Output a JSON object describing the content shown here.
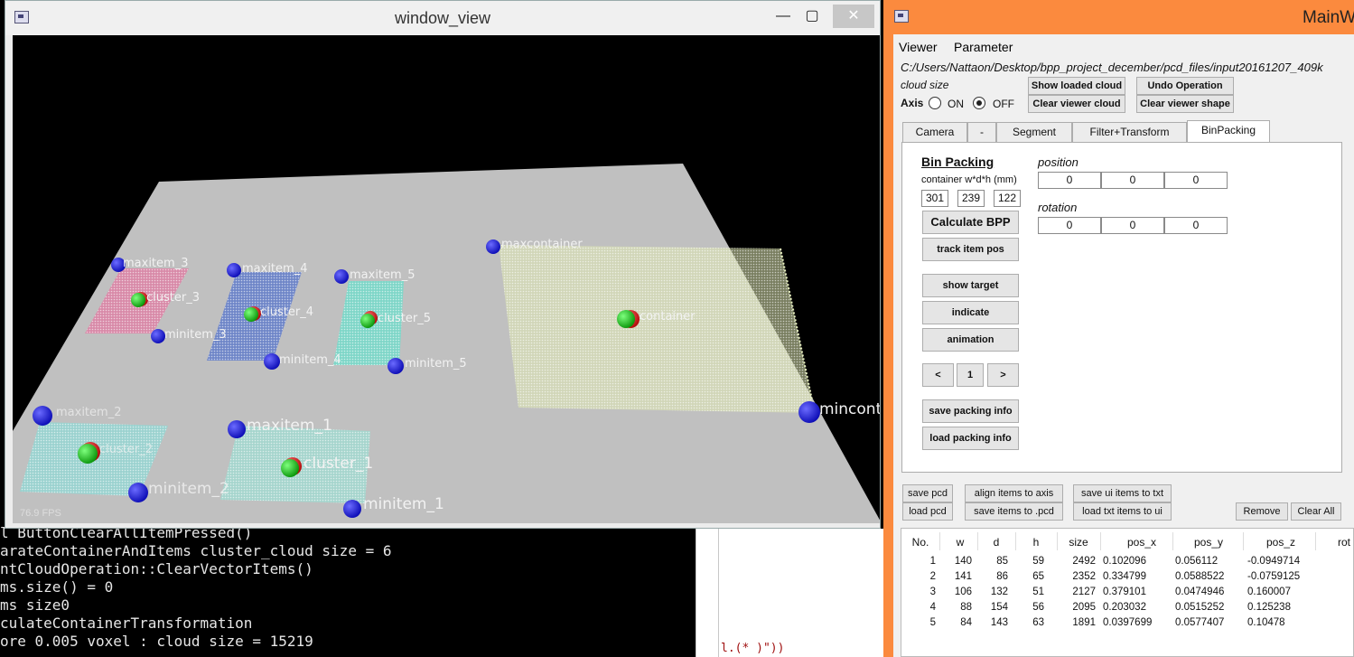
{
  "console": {
    "lines": [
      "l ButtonClearAllItemPressed()",
      "arateContainerAndItems cluster_cloud size = 6",
      "ntCloudOperation::ClearVectorItems()",
      "ms.size() = 0",
      "ms size0",
      "culateContainerTransformation",
      "ore 0.005 voxel : cloud size = 15219"
    ],
    "code_fragment": "l.(*  )\"))"
  },
  "viewer": {
    "title": "window_view",
    "fps": "76.9 FPS",
    "labels": {
      "maxitem_3": "maxitem_3",
      "maxitem_4": "maxitem_4",
      "maxitem_5": "maxitem_5",
      "maxitem_2": "maxitem_2",
      "maxitem_1": "maxitem_1",
      "minitem_3": "minitem_3",
      "minitem_4": "minitem_4",
      "minitem_5": "minitem_5",
      "minitem_2": "minitem_2",
      "minitem_1": "minitem_1",
      "maxcontainer": "maxcontainer",
      "mincontainer": "mincont",
      "cluster_3": "cluster_3",
      "cluster_4": "cluster_4",
      "cluster_5": "cluster_5",
      "cluster_2": "cluster_2",
      "cluster_1": "cluster_1",
      "container": "container"
    }
  },
  "main": {
    "title": "MainW",
    "menu": [
      "Viewer",
      "Parameter"
    ],
    "path": "C:/Users/Nattaon/Desktop/bpp_project_december/pcd_files/input20161207_409k",
    "cloud_size_label": "cloud size",
    "axis_label": "Axis",
    "axis_on": "ON",
    "axis_off": "OFF",
    "buttons": {
      "show_loaded": "Show loaded cloud",
      "clear_viewer_cloud": "Clear viewer cloud",
      "undo": "Undo Operation",
      "clear_viewer_shape": "Clear viewer shape"
    },
    "tabs": [
      "Camera",
      "-",
      "Segment",
      "Filter+Transform",
      "BinPacking"
    ],
    "binpacking": {
      "heading": "Bin Packing",
      "container_label": "container w*d*h (mm)",
      "w": "301",
      "d": "239",
      "h": "122",
      "calc": "Calculate BPP",
      "track": "track item pos",
      "show_target": "show target",
      "indicate": "indicate",
      "animation": "animation",
      "prev": "<",
      "index": "1",
      "next": ">",
      "save_info": "save packing info",
      "load_info": "load packing info",
      "position_label": "position",
      "position": [
        "0",
        "0",
        "0"
      ],
      "rotation_label": "rotation",
      "rotation": [
        "0",
        "0",
        "0"
      ]
    },
    "bottom_buttons": {
      "save_pcd": "save pcd",
      "load_pcd": "load pcd",
      "align": "align items to axis",
      "save_items_pcd": "save items to .pcd",
      "save_ui_txt": "save ui items to txt",
      "load_txt": "load txt items to ui",
      "remove": "Remove",
      "clear_all": "Clear All"
    },
    "table": {
      "columns": [
        "No.",
        "w",
        "d",
        "h",
        "size",
        "pos_x",
        "pos_y",
        "pos_z",
        "rot"
      ],
      "rows": [
        [
          "1",
          "140",
          "85",
          "59",
          "2492",
          "0.102096",
          "0.056112",
          "-0.0949714"
        ],
        [
          "2",
          "141",
          "86",
          "65",
          "2352",
          "0.334799",
          "0.0588522",
          "-0.0759125"
        ],
        [
          "3",
          "106",
          "132",
          "51",
          "2127",
          "0.379101",
          "0.0474946",
          "0.160007"
        ],
        [
          "4",
          "88",
          "154",
          "56",
          "2095",
          "0.203032",
          "0.0515252",
          "0.125238"
        ],
        [
          "5",
          "84",
          "143",
          "63",
          "1891",
          "0.0397699",
          "0.0577407",
          "0.10478"
        ]
      ]
    }
  },
  "colors": {
    "main_frame": "#fb8a3e",
    "plane": "#c0c0c0",
    "marker_blue": "#1010e0",
    "marker_green": "#10c010",
    "marker_red": "#e01010",
    "item_3": "#d88aa8",
    "item_4": "#6f86c8",
    "item_5": "#7fd6c8",
    "container_cloud": "#dfe8b0"
  }
}
